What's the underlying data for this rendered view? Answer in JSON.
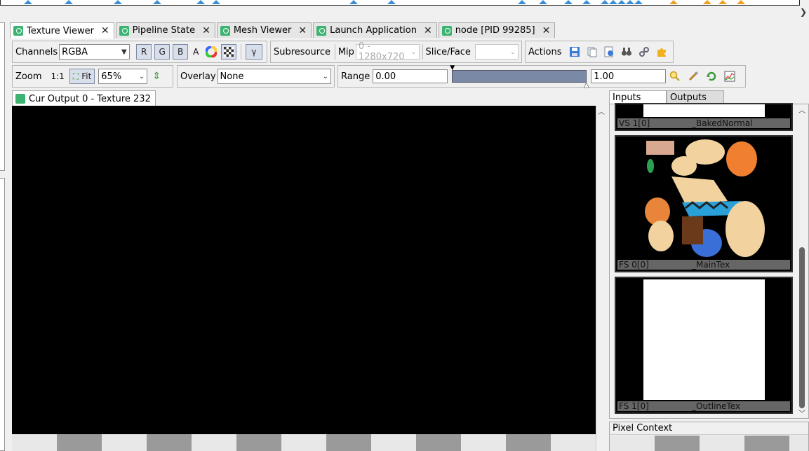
{
  "tabs": [
    {
      "label": "Texture Viewer",
      "active": true
    },
    {
      "label": "Pipeline State",
      "active": false
    },
    {
      "label": "Mesh Viewer",
      "active": false
    },
    {
      "label": "Launch Application",
      "active": false
    },
    {
      "label": "node [PID 99285]",
      "active": false
    }
  ],
  "channels": {
    "label": "Channels",
    "value": "RGBA",
    "r": "R",
    "g": "G",
    "b": "B",
    "a": "A",
    "gamma": "γ"
  },
  "subresource": {
    "label": "Subresource",
    "mip_label": "Mip",
    "mip_value": "0 - 1280x720",
    "slice_label": "Slice/Face",
    "slice_value": ""
  },
  "actions": {
    "label": "Actions"
  },
  "zoom": {
    "label": "Zoom",
    "one_to_one": "1:1",
    "fit": "Fit",
    "value": "65%"
  },
  "overlay": {
    "label": "Overlay",
    "value": "None"
  },
  "range": {
    "label": "Range",
    "min": "0.00",
    "max": "1.00"
  },
  "output": {
    "title": "Cur Output 0 - Texture 232"
  },
  "right_tabs": {
    "inputs": "Inputs",
    "outputs": "Outputs"
  },
  "thumbnails": [
    {
      "slot": "VS 1[0]",
      "name": "_BakedNormal"
    },
    {
      "slot": "FS 0[0]",
      "name": "_MainTex"
    },
    {
      "slot": "FS 1[0]",
      "name": "_OutlineTex"
    }
  ],
  "pixel_context": {
    "title": "Pixel Context"
  },
  "colors": {
    "accent_tab_icon": "#3cb371",
    "button_bg": "#d8deea",
    "range_bar": "#7a8aa6"
  }
}
